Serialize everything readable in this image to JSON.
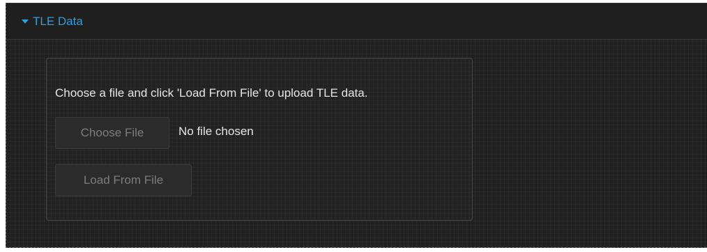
{
  "section": {
    "title": "TLE Data",
    "expanded": true,
    "accent_color": "#2e9fe0",
    "caret_icon": "caret-down-icon"
  },
  "upload": {
    "instructions": "Choose a file and click 'Load From File' to upload TLE data.",
    "choose_file_label": "Choose File",
    "file_status": "No file chosen",
    "load_button_label": "Load From File"
  }
}
